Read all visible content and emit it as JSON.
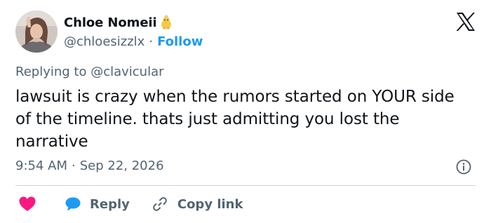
{
  "author": {
    "display_name": "Chloe Nomeii",
    "handle": "@chloesizzlx",
    "separator": "·",
    "follow_label": "Follow",
    "name_emoji": "baby-chick-icon"
  },
  "reply_context": {
    "prefix": "Replying to ",
    "mention": "@clavicular"
  },
  "tweet": {
    "text": "lawsuit is crazy when the rumors started on YOUR side of the timeline. thats just admitting you lost the narrative",
    "time": "9:54 AM",
    "separator": "·",
    "date": "Sep 22, 2026"
  },
  "actions": {
    "like_icon": "heart-icon",
    "reply_label": "Reply",
    "copy_label": "Copy link"
  },
  "colors": {
    "accent": "#1d9bf0",
    "like": "#f91880",
    "muted": "#536471",
    "text": "#0f1419",
    "divider": "#cfd9de"
  }
}
